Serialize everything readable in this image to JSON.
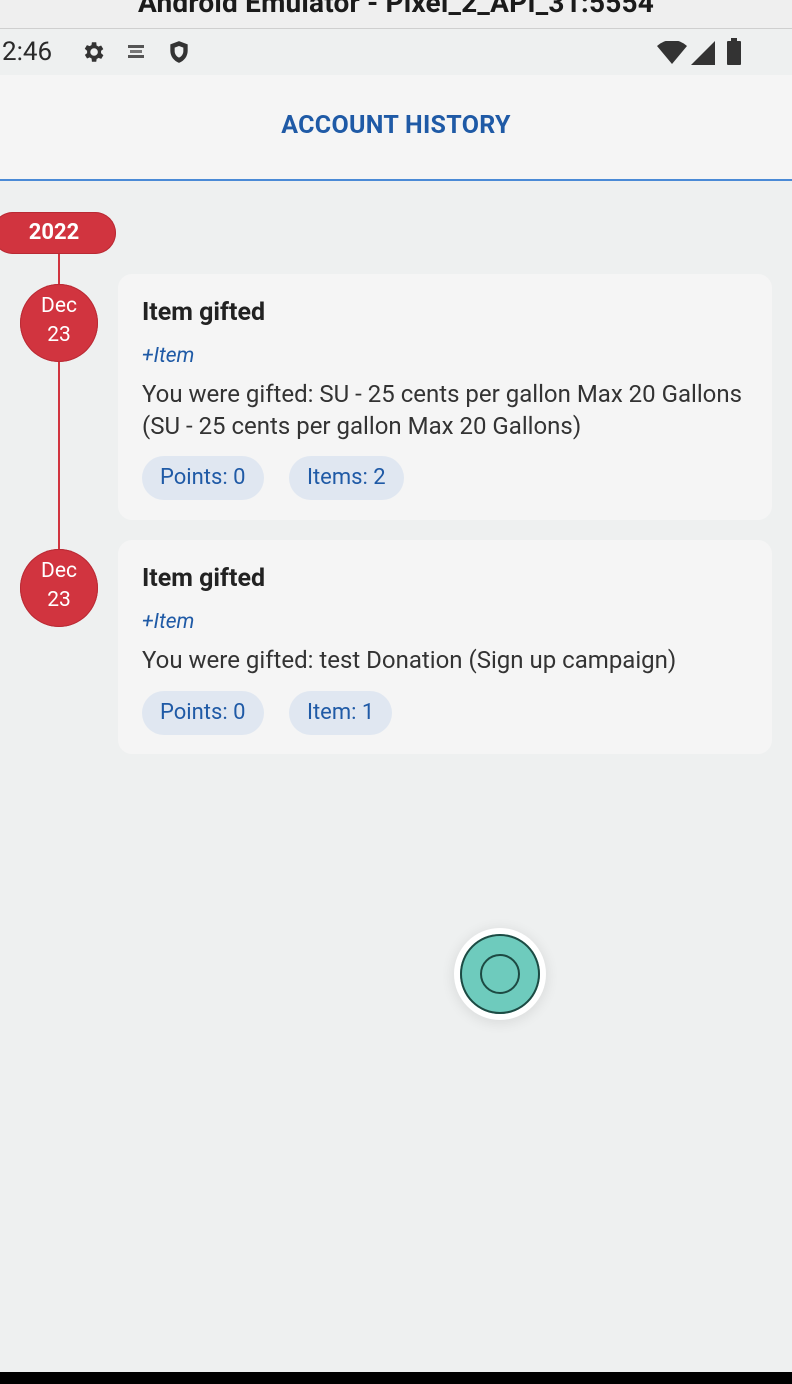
{
  "window": {
    "title": "Android Emulator - Pixel_2_API_31:5554"
  },
  "status_bar": {
    "time": "2:46",
    "left_icons": [
      "gear-icon",
      "app-notification-icon",
      "shield-icon"
    ],
    "right_icons": [
      "wifi-icon",
      "signal-icon",
      "battery-icon"
    ]
  },
  "header": {
    "title": "ACCOUNT HISTORY"
  },
  "timeline": {
    "year": "2022",
    "entries": [
      {
        "month": "Dec",
        "day": "23",
        "title": "Item gifted",
        "tag": "+Item",
        "description": "You were gifted: SU - 25 cents per gallon Max 20 Gallons (SU - 25 cents per gallon Max 20 Gallons)",
        "chips": [
          "Points: 0",
          "Items: 2"
        ]
      },
      {
        "month": "Dec",
        "day": "23",
        "title": "Item gifted",
        "tag": "+Item",
        "description": "You were gifted: test Donation (Sign up campaign)",
        "chips": [
          "Points: 0",
          "Item: 1"
        ]
      }
    ]
  },
  "colors": {
    "accent": "#1f5aa6",
    "timeline": "#d1343f",
    "fab": "#6ecbbd"
  }
}
